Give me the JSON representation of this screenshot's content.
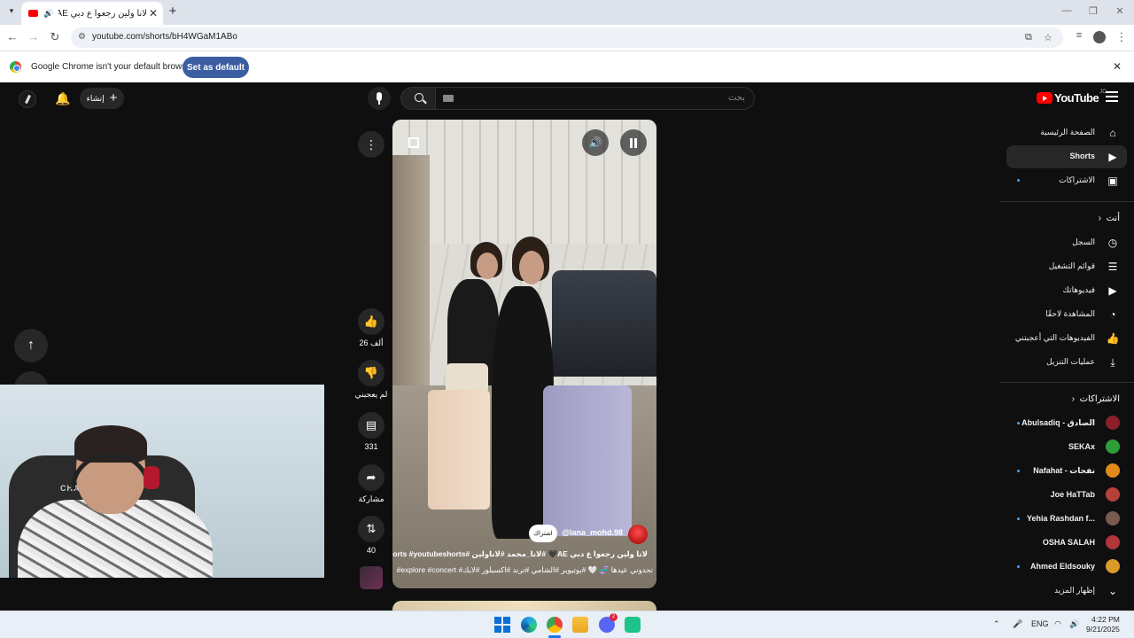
{
  "browser": {
    "tab_title": "لانا ولين رجعوا ع دبي AE🖤 #...",
    "url": "youtube.com/shorts/bH4WGaM1ABo",
    "infobar_text": "Google Chrome isn't your default browser",
    "set_default_label": "Set as default"
  },
  "masthead": {
    "logo_text": "YouTube",
    "logo_country": "JO",
    "search_placeholder": "بحث",
    "create_label": "إنشاء"
  },
  "short": {
    "channel_name": "@lana_mohd.98",
    "subscribe_label": "اشتراك",
    "caption_line1": "لانا ولين رجعوا ع دبي AE🖤 #لانا_محمد #لاناولين #shorts #youtubeshorts",
    "caption_line2": "تحدوني عيدها 🧬 🤍 #يوتيوبر #الشامي #ترند #اكسبلور #لايك# explore #concert#"
  },
  "actions": {
    "like_count": "26 ألف",
    "dislike_label": "لم يعجبني",
    "comments_count": "331",
    "share_label": "مشاركة",
    "remix_count": "40"
  },
  "sidebar": {
    "main": [
      {
        "label": "الصفحة الرئيسية",
        "icon": "home-icon"
      },
      {
        "label": "Shorts",
        "icon": "shorts-icon",
        "active": true
      },
      {
        "label": "الاشتراكات",
        "icon": "subscriptions-icon"
      }
    ],
    "you_heading": "أنت",
    "you": [
      {
        "label": "السجل",
        "icon": "history-icon"
      },
      {
        "label": "قوائم التشغيل",
        "icon": "playlists-icon"
      },
      {
        "label": "فيديوهاتك",
        "icon": "your-videos-icon"
      },
      {
        "label": "المشاهدة لاحقًا",
        "icon": "watch-later-icon"
      },
      {
        "label": "الفيديوهات التي أعجبتني",
        "icon": "liked-icon"
      },
      {
        "label": "عمليات التنزيل",
        "icon": "download-icon"
      }
    ],
    "subs_heading": "الاشتراكات",
    "subscriptions": [
      {
        "label": "Abulsadiq - الصادق",
        "color": "#8b1f2a"
      },
      {
        "label": "SEKAx",
        "color": "#2e9e3a"
      },
      {
        "label": "Nafahat - نفحات",
        "color": "#e38a1c"
      },
      {
        "label": "Joe HaTTab",
        "color": "#b8403a"
      },
      {
        "label": "Yehia Rashdan f...",
        "color": "#7a5a50"
      },
      {
        "label": "OSHA SALAH",
        "color": "#b0363c"
      },
      {
        "label": "Ahmed Eldsouky",
        "color": "#d99a2a"
      }
    ],
    "show_more": "إظهار المزيد"
  },
  "webcam": {
    "chair_label": "CHAR"
  },
  "taskbar": {
    "lang": "ENG",
    "time": "4:22 PM",
    "date": "9/21/2025",
    "discord_badge": "2"
  }
}
